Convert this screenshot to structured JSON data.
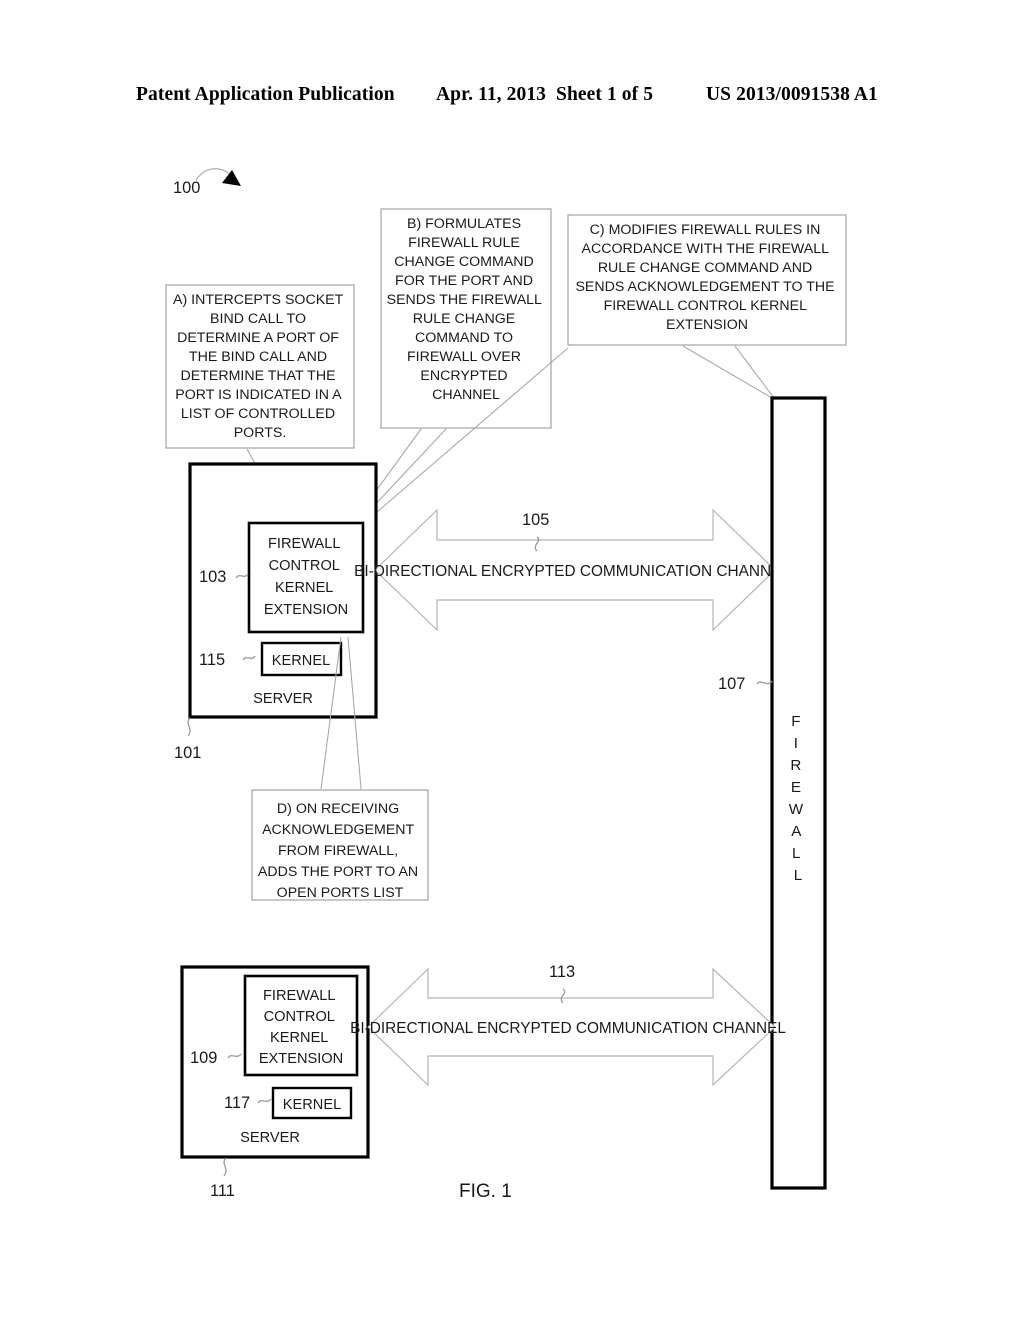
{
  "publication_header": {
    "left": "Patent Application Publication",
    "date": "Apr. 11, 2013",
    "sheet": "Sheet 1 of 5",
    "doc_number": "US 2013/0091538 A1"
  },
  "figure": {
    "caption": "FIG. 1",
    "figure_ref": "100",
    "steps": [
      {
        "id": "step-a",
        "label": "A) INTERCEPTS SOCKET BIND CALL TO DETERMINE A PORT OF THE BIND CALL AND DETERMINE THAT THE PORT IS INDICATED IN A LIST OF CONTROLLED PORTS.",
        "lines": [
          "A) INTERCEPTS SOCKET",
          "BIND CALL TO",
          "DETERMINE A PORT OF",
          "THE BIND CALL AND",
          "DETERMINE THAT THE",
          "PORT IS INDICATED IN A",
          "LIST OF CONTROLLED",
          "PORTS."
        ]
      },
      {
        "id": "step-b",
        "label": "B) FORMULATES FIREWALL RULE CHANGE COMMAND FOR THE PORT AND SENDS THE FIREWALL RULE CHANGE COMMAND TO FIREWALL OVER ENCRYPTED CHANNEL",
        "lines": [
          "B) FORMULATES",
          "FIREWALL RULE",
          "CHANGE COMMAND",
          "FOR THE PORT AND",
          "SENDS THE FIREWALL",
          "RULE CHANGE",
          "COMMAND TO",
          "FIREWALL OVER",
          "ENCRYPTED",
          "CHANNEL"
        ]
      },
      {
        "id": "step-c",
        "label": "C) MODIFIES FIREWALL RULES IN ACCORDANCE WITH THE FIREWALL RULE CHANGE COMMAND AND SENDS ACKNOWLEDGEMENT TO THE FIREWALL CONTROL KERNEL EXTENSION",
        "lines": [
          "C) MODIFIES FIREWALL RULES IN",
          "ACCORDANCE WITH THE FIREWALL",
          "RULE CHANGE COMMAND AND",
          "SENDS ACKNOWLEDGEMENT TO THE",
          "FIREWALL CONTROL KERNEL",
          "EXTENSION"
        ]
      },
      {
        "id": "step-d",
        "label": "D) ON RECEIVING ACKNOWLEDGEMENT FROM FIREWALL, ADDS THE PORT TO AN OPEN PORTS LIST",
        "lines": [
          "D) ON RECEIVING",
          "ACKNOWLEDGEMENT",
          "FROM FIREWALL,",
          "ADDS THE PORT TO AN",
          "OPEN PORTS LIST"
        ]
      }
    ],
    "servers": [
      {
        "id": "server-top",
        "ref": "101",
        "label": "SERVER",
        "kernel_extension": {
          "ref": "103",
          "lines": [
            "FIREWALL",
            "CONTROL",
            "KERNEL",
            "EXTENSION"
          ],
          "label": "FIREWALL CONTROL KERNEL EXTENSION"
        },
        "kernel": {
          "ref": "115",
          "label": "KERNEL"
        }
      },
      {
        "id": "server-bottom",
        "ref": "111",
        "label": "SERVER",
        "kernel_extension": {
          "ref": "109",
          "lines": [
            "FIREWALL",
            "CONTROL",
            "KERNEL",
            "EXTENSION"
          ],
          "label": "FIREWALL CONTROL KERNEL EXTENSION"
        },
        "kernel": {
          "ref": "117",
          "label": "KERNEL"
        }
      }
    ],
    "firewall": {
      "id": "firewall",
      "ref": "107",
      "label": "FIREWALL",
      "letters": [
        "F",
        "I",
        "R",
        "E",
        "W",
        "A",
        "L",
        "L"
      ]
    },
    "channels": [
      {
        "id": "channel-top",
        "ref": "105",
        "label": "BI-DIRECTIONAL ENCRYPTED COMMUNICATION CHANNEL"
      },
      {
        "id": "channel-bottom",
        "ref": "113",
        "label": "BI-DIRECTIONAL ENCRYPTED COMMUNICATION CHANNEL"
      }
    ]
  }
}
